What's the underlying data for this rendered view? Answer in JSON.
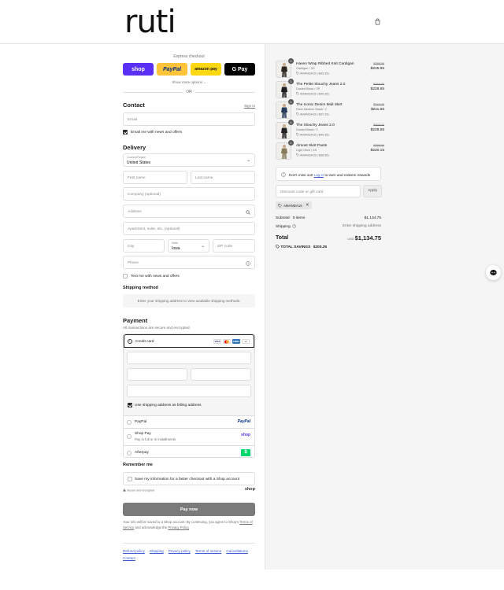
{
  "brand": {
    "logo": "ruti"
  },
  "express": {
    "title": "Express checkout",
    "shop": "shop",
    "paypal": "PayPal",
    "amazon": "amazon pay",
    "gpay": "G Pay",
    "show_more": "Show more options",
    "or": "OR"
  },
  "contact": {
    "heading": "Contact",
    "sign_in": "Sign in",
    "email_placeholder": "Email",
    "email_news": "Email me with news and offers"
  },
  "delivery": {
    "heading": "Delivery",
    "country_label": "Country/Region",
    "country_value": "United States",
    "first_name": "First name",
    "last_name": "Last name",
    "company": "Company (optional)",
    "address": "Address",
    "apartment": "Apartment, suite, etc. (optional)",
    "city": "City",
    "state_label": "State",
    "state_value": "Iowa",
    "zip": "ZIP code",
    "phone": "Phone",
    "text_news": "Text me with news and offers"
  },
  "shipping": {
    "heading": "Shipping method",
    "info": "Enter your shipping address to view available shipping methods."
  },
  "payment": {
    "heading": "Payment",
    "subtext": "All transactions are secure and encrypted.",
    "credit_card": "Credit card",
    "card_visa": "VISA",
    "card_amex": "AMEX",
    "card_more": "+1",
    "billing_same": "Use shipping address as billing address",
    "paypal": "PayPal",
    "paypal_logo": "PayPal",
    "shop_pay": "Shop Pay",
    "shop_pay_sub": "Pay in full or in installments",
    "shop_logo": "shop",
    "afterpay": "Afterpay",
    "afterpay_logo": "$"
  },
  "remember": {
    "heading": "Remember me",
    "save_info": "Save my information for a faster checkout with a Shop account",
    "secure": "Secure and encrypted",
    "shop_logo": "shop"
  },
  "pay_now": "Pay now",
  "legal": {
    "line1": "Your info will be saved to a Shop account. By continuing, you agree to Shop's",
    "tos": "Terms of Service",
    "and": "and acknowledge the",
    "privacy": "Privacy Policy"
  },
  "footer": [
    "Refund policy",
    "Shipping",
    "Privacy policy",
    "Terms of service",
    "Cancellations",
    "Contact"
  ],
  "items": [
    {
      "qty": "1",
      "name": "Haven Wrap Ribbed Knit Cardigan",
      "variant": "Cardigan / XS",
      "discount": "AMANDA15 (-$43.35)",
      "old": "$289.00",
      "new": "$245.65"
    },
    {
      "qty": "1",
      "name": "The Petite Slouchy Jeans 2.0",
      "variant": "Dusted Black / 2P",
      "discount": "AMANDA15 (-$40.35)",
      "old": "$269.00",
      "new": "$228.65"
    },
    {
      "qty": "1",
      "name": "The Iconic Denim Midi Skirt",
      "variant": "Paris Medium Wash / 2",
      "discount": "AMANDA15 (-$37.35)",
      "old": "$249.00",
      "new": "$211.65"
    },
    {
      "qty": "1",
      "name": "The Slouchy Jeans 2.0",
      "variant": "Dusted Black / 2",
      "discount": "AMANDA15 (-$40.35)",
      "old": "$269.00",
      "new": "$228.65"
    },
    {
      "qty": "1",
      "name": "Almost Skirt Pants",
      "variant": "Light Olive / XS",
      "discount": "AMANDA15 (-$38.85)",
      "old": "$259.00",
      "new": "$220.15"
    }
  ],
  "rewards": {
    "pre": "Don't miss out!",
    "link": "Log in",
    "post": "to earn and redeem rewards"
  },
  "discount": {
    "placeholder": "Discount code or gift card",
    "apply": "Apply",
    "tag": "AMANDA15"
  },
  "summary": {
    "subtotal_label": "Subtotal · 5 items",
    "subtotal_value": "$1,134.75",
    "shipping_label": "Shipping",
    "shipping_value": "Enter shipping address",
    "total_label": "Total",
    "currency": "USD",
    "total_value": "$1,134.75",
    "savings_label": "TOTAL SAVINGS",
    "savings_value": "$200.25"
  },
  "colors": {
    "shop_purple": "#5a31f4",
    "paypal_yellow": "#ffc439",
    "amazon_yellow": "#ffd814",
    "afterpay_green": "#00d76c",
    "link_blue": "#3c5bd6",
    "pay_button": "#7a7a7a"
  }
}
